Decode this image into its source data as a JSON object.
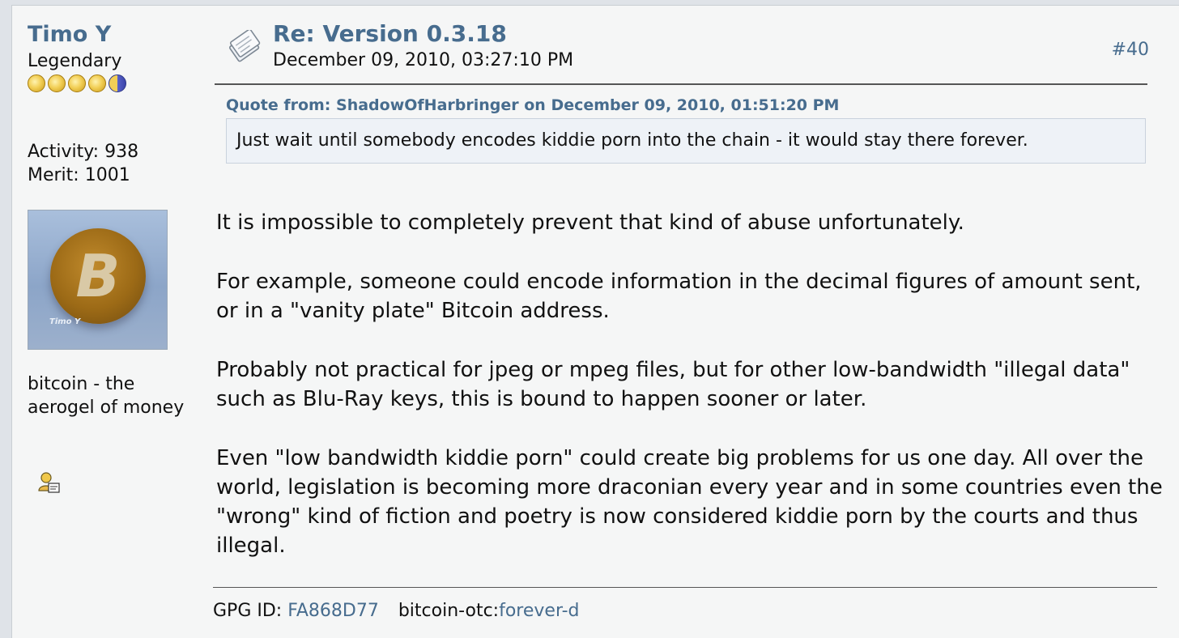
{
  "poster": {
    "name": "Timo Y",
    "rank": "Legendary",
    "activity": "Activity: 938",
    "merit": "Merit: 1001",
    "avatar_caption": "Timo Y",
    "personal_text": "bitcoin - the aerogel of money"
  },
  "post": {
    "subject": "Re: Version 0.3.18",
    "date": "December 09, 2010, 03:27:10 PM",
    "number": "#40",
    "quote_header": "Quote from: ShadowOfHarbringer on December 09, 2010, 01:51:20 PM",
    "quote_text": "Just wait until somebody encodes kiddie porn into the chain - it would stay there forever.",
    "paragraphs": [
      "It is impossible to completely prevent that kind of abuse unfortunately.",
      "For example, someone could encode information in the decimal figures of amount sent, or in a \"vanity plate\" Bitcoin address.",
      "Probably not practical for jpeg or mpeg files, but for other low-bandwidth \"illegal data\" such as Blu-Ray keys, this is bound to happen sooner or later.",
      "Even \"low bandwidth kiddie porn\" could create big problems for us one day. All over the world, legislation is becoming more draconian every year and in some countries even the \"wrong\" kind of fiction and poetry is now considered kiddie porn by the courts and thus illegal."
    ]
  },
  "signature": {
    "gpg_label": "GPG ID:",
    "gpg_id": "FA868D77",
    "otc_label": "bitcoin-otc:",
    "otc_link": "forever-d"
  },
  "colors": {
    "link": "#476c8e",
    "background": "#f5f6f6",
    "quote_background": "#eef2f7"
  },
  "icons": {
    "post_icon": "post-document-icon",
    "profile_icon": "user-profile-icon",
    "stars": "rank-star-icon"
  }
}
